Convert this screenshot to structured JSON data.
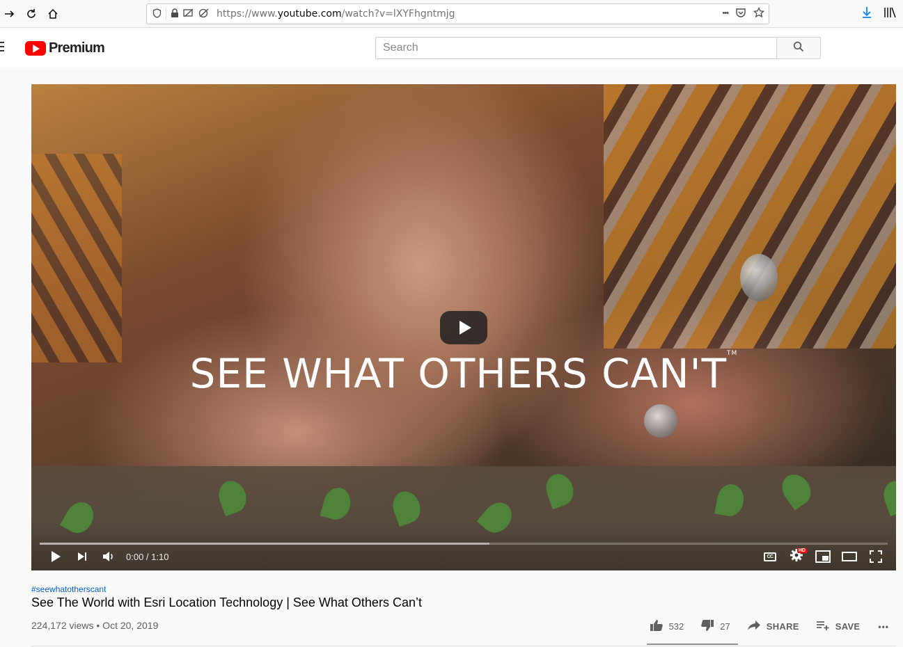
{
  "browser": {
    "url_prefix": "https://www.",
    "url_host": "youtube.com",
    "url_path": "/watch?v=lXYFhgntmjg",
    "more_label": "•••"
  },
  "header": {
    "logo_text": "Premium",
    "search_placeholder": "Search"
  },
  "player": {
    "overlay_text": "SEE WHAT OTHERS CAN'T",
    "trademark": "TM",
    "time": "0:00 / 1:10",
    "loaded_fraction": 0.53,
    "cc_label": "CC",
    "hd_label": "HD"
  },
  "video": {
    "hashtag": "#seewhatotherscant",
    "title": "See The World with Esri Location Technology | See What Others Can’t",
    "views": "224,172 views • Oct 20, 2019"
  },
  "actions": {
    "likes": "532",
    "dislikes": "27",
    "share_label": "SHARE",
    "save_label": "SAVE",
    "more_label": "•••"
  },
  "colors": {
    "brand_red": "#ff0000",
    "link_blue": "#065fd4"
  }
}
